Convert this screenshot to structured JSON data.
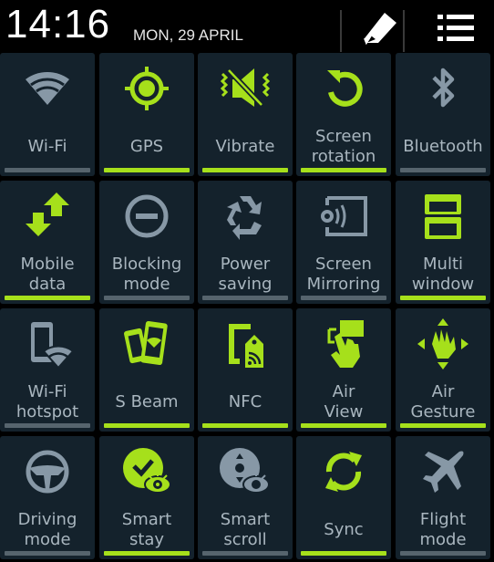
{
  "status_bar": {
    "time": "14:16",
    "date": "MON, 29 APRIL",
    "edit_icon": "pencil-icon",
    "list_icon": "list-icon"
  },
  "colors": {
    "active": "#a6e01b",
    "inactive_icon": "#8798a6",
    "inactive_bar": "#56646d",
    "tile_bg": "#14222c",
    "label": "#a9b6bf"
  },
  "toggles": [
    {
      "id": "wifi",
      "label": [
        "Wi-Fi"
      ],
      "icon": "wifi-icon",
      "active": false
    },
    {
      "id": "gps",
      "label": [
        "GPS"
      ],
      "icon": "gps-icon",
      "active": true
    },
    {
      "id": "vibrate",
      "label": [
        "Vibrate"
      ],
      "icon": "vibrate-icon",
      "active": true
    },
    {
      "id": "screen-rotation",
      "label": [
        "Screen",
        "rotation"
      ],
      "icon": "rotate-icon",
      "active": true
    },
    {
      "id": "bluetooth",
      "label": [
        "Bluetooth"
      ],
      "icon": "bluetooth-icon",
      "active": false
    },
    {
      "id": "mobile-data",
      "label": [
        "Mobile",
        "data"
      ],
      "icon": "data-arrows-icon",
      "active": true
    },
    {
      "id": "blocking-mode",
      "label": [
        "Blocking",
        "mode"
      ],
      "icon": "block-icon",
      "active": false
    },
    {
      "id": "power-saving",
      "label": [
        "Power",
        "saving"
      ],
      "icon": "recycle-icon",
      "active": false
    },
    {
      "id": "screen-mirroring",
      "label": [
        "Screen",
        "Mirroring"
      ],
      "icon": "mirroring-icon",
      "active": false
    },
    {
      "id": "multi-window",
      "label": [
        "Multi",
        "window"
      ],
      "icon": "multi-window-icon",
      "active": true
    },
    {
      "id": "wifi-hotspot",
      "label": [
        "Wi-Fi",
        "hotspot"
      ],
      "icon": "hotspot-icon",
      "active": false
    },
    {
      "id": "s-beam",
      "label": [
        "S Beam"
      ],
      "icon": "s-beam-icon",
      "active": true
    },
    {
      "id": "nfc",
      "label": [
        "NFC"
      ],
      "icon": "nfc-icon",
      "active": true
    },
    {
      "id": "air-view",
      "label": [
        "Air",
        "View"
      ],
      "icon": "air-view-icon",
      "active": true
    },
    {
      "id": "air-gesture",
      "label": [
        "Air",
        "Gesture"
      ],
      "icon": "air-gesture-icon",
      "active": true
    },
    {
      "id": "driving-mode",
      "label": [
        "Driving",
        "mode"
      ],
      "icon": "steering-wheel-icon",
      "active": false
    },
    {
      "id": "smart-stay",
      "label": [
        "Smart",
        "stay"
      ],
      "icon": "smart-stay-icon",
      "active": true
    },
    {
      "id": "smart-scroll",
      "label": [
        "Smart",
        "scroll"
      ],
      "icon": "smart-scroll-icon",
      "active": false
    },
    {
      "id": "sync",
      "label": [
        "Sync"
      ],
      "icon": "sync-icon",
      "active": true
    },
    {
      "id": "flight-mode",
      "label": [
        "Flight",
        "mode"
      ],
      "icon": "airplane-icon",
      "active": false
    }
  ]
}
